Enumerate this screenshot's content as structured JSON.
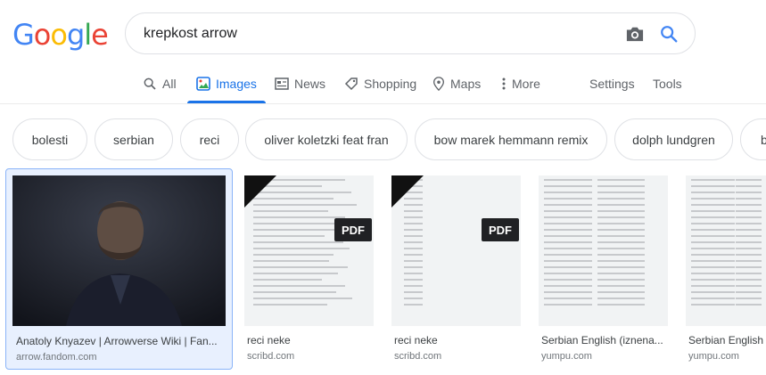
{
  "logo": {
    "letters": [
      "G",
      "o",
      "o",
      "g",
      "l",
      "e"
    ],
    "colors": [
      "#4285F4",
      "#EA4335",
      "#FBBC05",
      "#4285F4",
      "#34A853",
      "#EA4335"
    ]
  },
  "search": {
    "query": "krepkost arrow",
    "camera_icon": "camera-icon",
    "search_icon": "search-icon"
  },
  "tabs": [
    {
      "label": "All",
      "icon": "search-icon",
      "active": false
    },
    {
      "label": "Images",
      "icon": "image-icon",
      "active": true
    },
    {
      "label": "News",
      "icon": "news-icon",
      "active": false
    },
    {
      "label": "Shopping",
      "icon": "tag-icon",
      "active": false
    },
    {
      "label": "Maps",
      "icon": "pin-icon",
      "active": false
    },
    {
      "label": "More",
      "icon": "more-vert-icon",
      "active": false
    }
  ],
  "settings_label": "Settings",
  "tools_label": "Tools",
  "chips": [
    "bolesti",
    "serbian",
    "reci",
    "oliver koletzki feat fran",
    "bow marek hemmann remix",
    "dolph lundgren",
    "b"
  ],
  "results": [
    {
      "title": "Anatoly Knyazev | Arrowverse Wiki | Fan...",
      "source": "arrow.fandom.com",
      "type": "photo"
    },
    {
      "title": "reci neke",
      "source": "scribd.com",
      "type": "pdf",
      "badge": "PDF"
    },
    {
      "title": "reci neke",
      "source": "scribd.com",
      "type": "pdf",
      "badge": "PDF"
    },
    {
      "title": "Serbian English (iznena...",
      "source": "yumpu.com",
      "type": "doc"
    },
    {
      "title": "Serbian English",
      "source": "yumpu.com",
      "type": "doc"
    }
  ],
  "colors": {
    "accent": "#1a73e8",
    "selected_bg": "#e8f0fe"
  }
}
